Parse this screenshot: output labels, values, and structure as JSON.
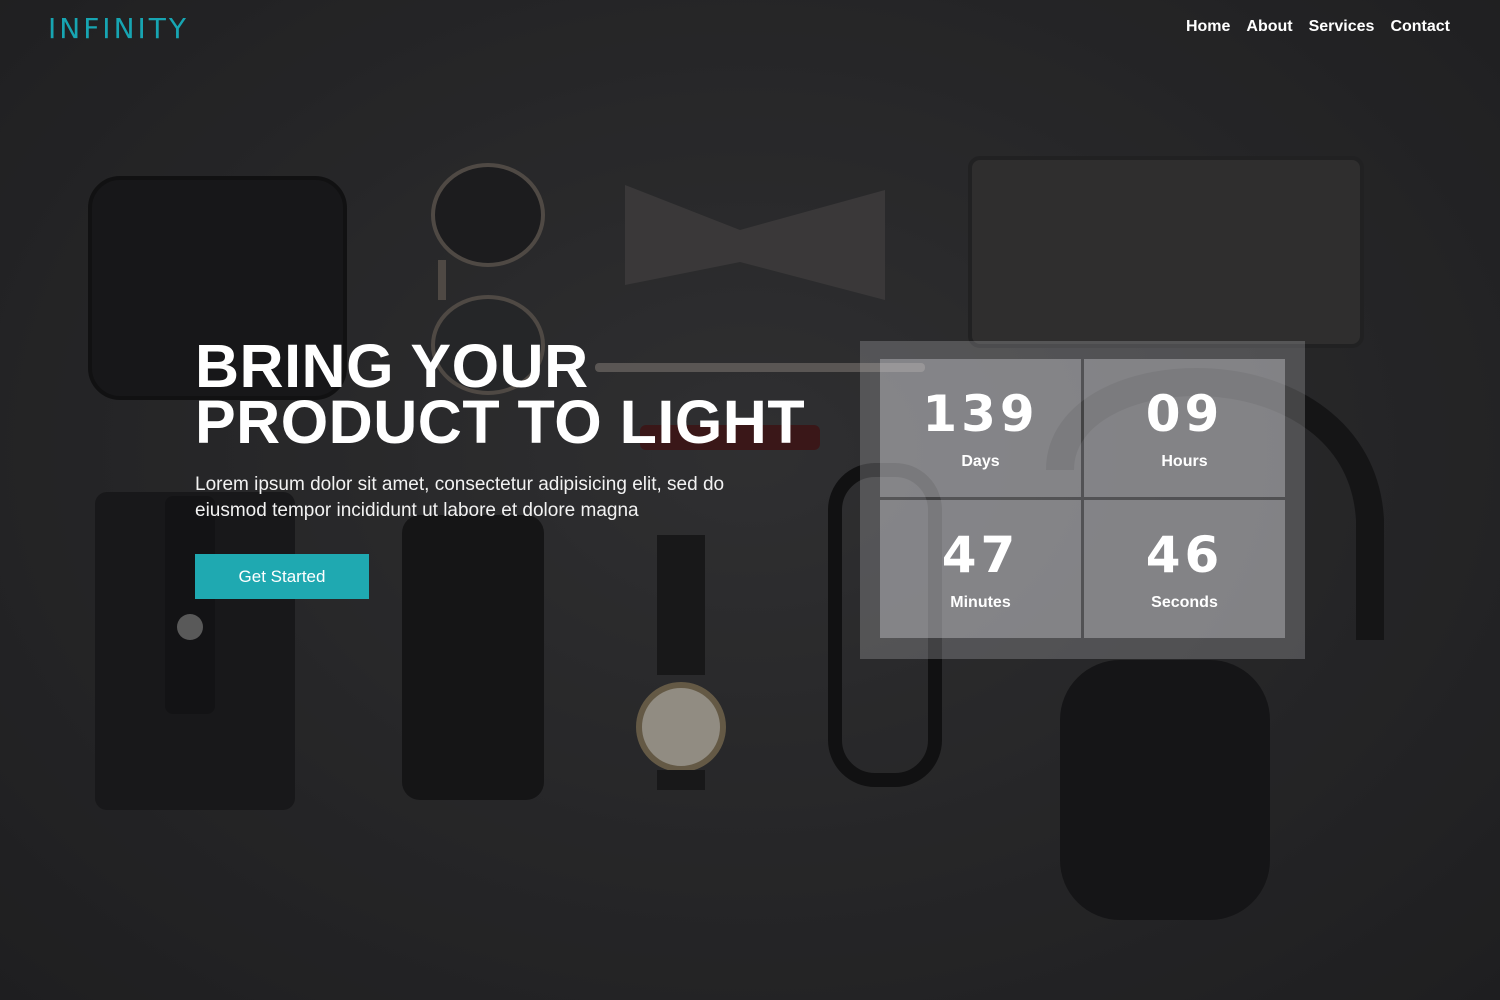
{
  "brand": {
    "logo": "INFINITY",
    "accent": "#17a5b2"
  },
  "nav": {
    "items": [
      "Home",
      "About",
      "Services",
      "Contact"
    ]
  },
  "hero": {
    "title_line1": "BRING YOUR",
    "title_line2": "PRODUCT TO LIGHT",
    "description": "Lorem ipsum dolor sit amet, consectetur adipisicing elit, sed do eiusmod tempor incididunt ut labore et dolore magna",
    "cta_label": "Get Started",
    "cta_color": "#1fa9b1"
  },
  "countdown": {
    "days": {
      "value": "139",
      "label": "Days"
    },
    "hours": {
      "value": "09",
      "label": "Hours"
    },
    "minutes": {
      "value": "47",
      "label": "Minutes"
    },
    "seconds": {
      "value": "46",
      "label": "Seconds"
    }
  }
}
